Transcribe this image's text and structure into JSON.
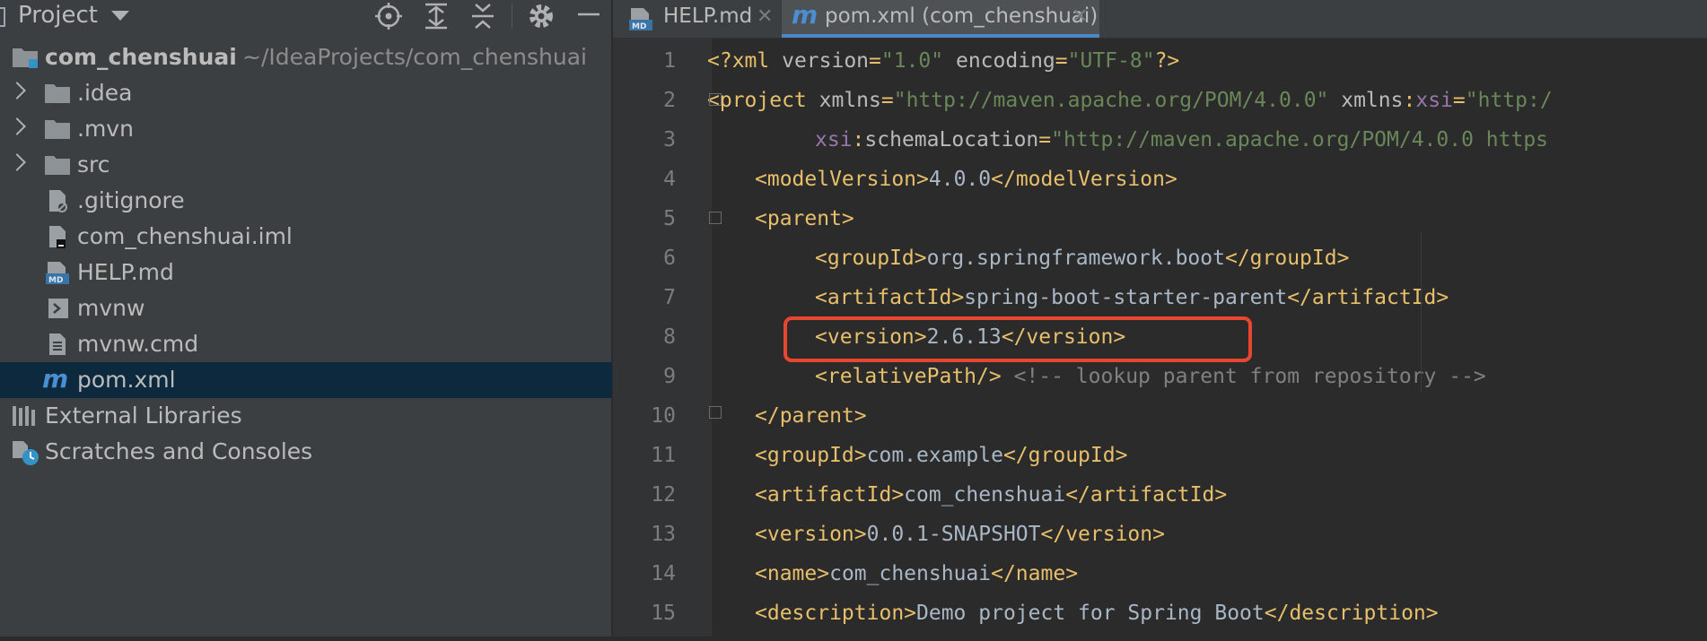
{
  "project_pane": {
    "title": "Project",
    "header_buttons": [
      "locate-icon",
      "expand-all-icon",
      "collapse-all-icon",
      "gear-icon",
      "minimize-icon"
    ],
    "tree": [
      {
        "label": "com_chenshuai",
        "path": "~/IdeaProjects/com_chenshuai",
        "icon": "module-folder-icon"
      },
      {
        "label": ".idea",
        "icon": "folder-icon"
      },
      {
        "label": ".mvn",
        "icon": "folder-icon"
      },
      {
        "label": "src",
        "icon": "folder-icon"
      },
      {
        "label": ".gitignore",
        "icon": "ignore-file-icon"
      },
      {
        "label": "com_chenshuai.iml",
        "icon": "iml-file-icon"
      },
      {
        "label": "HELP.md",
        "icon": "markdown-file-icon"
      },
      {
        "label": "mvnw",
        "icon": "shell-script-icon"
      },
      {
        "label": "mvnw.cmd",
        "icon": "text-file-icon"
      },
      {
        "label": "pom.xml",
        "icon": "maven-icon",
        "selected": true
      },
      {
        "label": "External Libraries",
        "icon": "libraries-icon"
      },
      {
        "label": "Scratches and Consoles",
        "icon": "scratches-icon"
      }
    ]
  },
  "editor": {
    "tabs": [
      {
        "label": "HELP.md",
        "icon": "markdown-file-icon",
        "active": false
      },
      {
        "label": "pom.xml (com_chenshuai)",
        "icon": "maven-icon",
        "active": true
      }
    ],
    "line_numbers": [
      "1",
      "2",
      "3",
      "4",
      "5",
      "6",
      "7",
      "8",
      "9",
      "10",
      "11",
      "12",
      "13",
      "14",
      "15"
    ],
    "lines": [
      [
        [
          "tag",
          "<?xml "
        ],
        [
          "attr",
          "version"
        ],
        [
          "tag",
          "="
        ],
        [
          "str",
          "\"1.0\""
        ],
        [
          "attr",
          " encoding"
        ],
        [
          "tag",
          "="
        ],
        [
          "str",
          "\"UTF-8\""
        ],
        [
          "tag",
          "?>"
        ]
      ],
      [
        [
          "tag",
          "<project "
        ],
        [
          "attr",
          "xmlns"
        ],
        [
          "tag",
          "="
        ],
        [
          "str",
          "\"http://maven.apache.org/POM/4.0.0\""
        ],
        [
          "attr",
          " xmlns"
        ],
        [
          "tag",
          ":"
        ],
        [
          "ns",
          "xsi"
        ],
        [
          "tag",
          "="
        ],
        [
          "str",
          "\"http:/"
        ]
      ],
      [
        [
          "ns",
          "xsi"
        ],
        [
          "tag",
          ":"
        ],
        [
          "attr",
          "schemaLocation"
        ],
        [
          "tag",
          "="
        ],
        [
          "str",
          "\"http://maven.apache.org/POM/4.0.0 https"
        ]
      ],
      [
        [
          "tag",
          "<modelVersion>"
        ],
        [
          "txt",
          "4.0.0"
        ],
        [
          "tag",
          "</modelVersion>"
        ]
      ],
      [
        [
          "tag",
          "<parent>"
        ]
      ],
      [
        [
          "tag",
          "<groupId>"
        ],
        [
          "txt",
          "org.springframework.boot"
        ],
        [
          "tag",
          "</groupId>"
        ]
      ],
      [
        [
          "tag",
          "<artifactId>"
        ],
        [
          "txt",
          "spring-boot-starter-parent"
        ],
        [
          "tag",
          "</artifactId>"
        ]
      ],
      [
        [
          "tag",
          "<version>"
        ],
        [
          "txt",
          "2.6.13"
        ],
        [
          "tag",
          "</version>"
        ]
      ],
      [
        [
          "tag",
          "<relativePath/>"
        ],
        [
          "cmt",
          " <!-- lookup parent from repository -->"
        ]
      ],
      [
        [
          "tag",
          "</parent>"
        ]
      ],
      [
        [
          "tag",
          "<groupId>"
        ],
        [
          "txt",
          "com.example"
        ],
        [
          "tag",
          "</groupId>"
        ]
      ],
      [
        [
          "tag",
          "<artifactId>"
        ],
        [
          "txt",
          "com_chenshuai"
        ],
        [
          "tag",
          "</artifactId>"
        ]
      ],
      [
        [
          "tag",
          "<version>"
        ],
        [
          "txt",
          "0.0.1-SNAPSHOT"
        ],
        [
          "tag",
          "</version>"
        ]
      ],
      [
        [
          "tag",
          "<name>"
        ],
        [
          "txt",
          "com_chenshuai"
        ],
        [
          "tag",
          "</name>"
        ]
      ],
      [
        [
          "tag",
          "<description>"
        ],
        [
          "txt",
          "Demo project for Spring Boot"
        ],
        [
          "tag",
          "</description>"
        ]
      ]
    ],
    "annotation": "highlighted-version-line"
  },
  "colors": {
    "tag": "#e8bf6a",
    "string": "#6a8759",
    "namespace": "#9876aa",
    "text": "#a9b7c6",
    "comment": "#808080",
    "highlight_box": "#e8462f",
    "selection": "#0d293e"
  }
}
